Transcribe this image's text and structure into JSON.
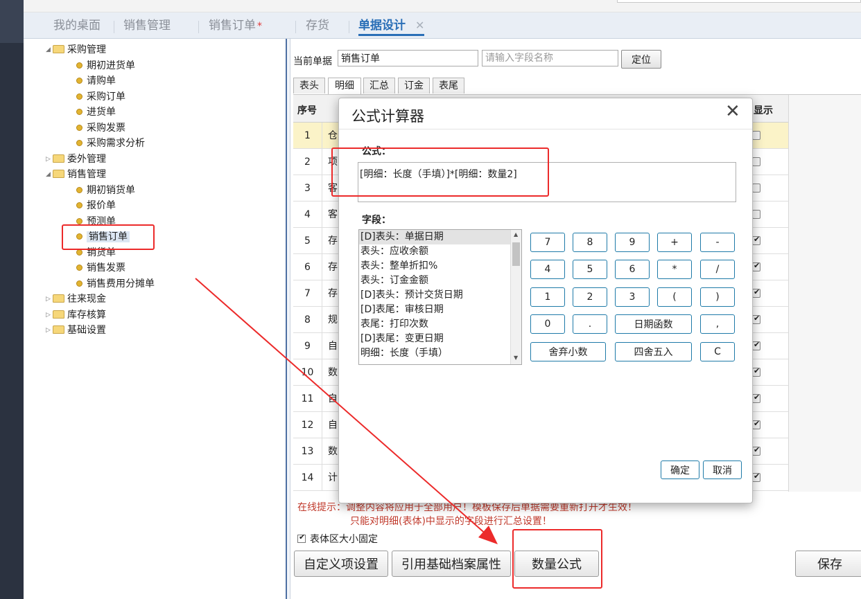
{
  "tabs": [
    {
      "label": "我的桌面"
    },
    {
      "label": "销售管理"
    },
    {
      "label": "销售订单",
      "modified": "*"
    },
    {
      "label": "存货"
    },
    {
      "label": "单据设计",
      "close": "✕"
    }
  ],
  "tree": {
    "groups": [
      {
        "label": "采购管理",
        "toggle": "◢",
        "children": [
          "期初进货单",
          "请购单",
          "采购订单",
          "进货单",
          "采购发票",
          "采购需求分析"
        ]
      },
      {
        "label": "委外管理",
        "toggle": "▷"
      },
      {
        "label": "销售管理",
        "toggle": "◢",
        "children": [
          "期初销货单",
          "报价单",
          "预测单",
          "销售订单",
          "销货单",
          "销售发票",
          "销售费用分摊单"
        ]
      },
      {
        "label": "往来现金",
        "toggle": "▷"
      },
      {
        "label": "库存核算",
        "toggle": "▷"
      },
      {
        "label": "基础设置",
        "toggle": "▷"
      }
    ]
  },
  "main": {
    "current_label": "当前单据",
    "current_value": "销售订单",
    "search_placeholder": "请输入字段名称",
    "locate_button": "定位",
    "subtabs": [
      "表头",
      "明细",
      "汇总",
      "订金",
      "表尾"
    ],
    "grid": {
      "col_index": "序号",
      "col_show": "显示",
      "rows": [
        {
          "no": "1",
          "text": "仓",
          "checked": false,
          "highlight": true
        },
        {
          "no": "2",
          "text": "项",
          "checked": false
        },
        {
          "no": "3",
          "text": "客",
          "checked": false
        },
        {
          "no": "4",
          "text": "客",
          "checked": false
        },
        {
          "no": "5",
          "text": "存",
          "checked": true
        },
        {
          "no": "6",
          "text": "存",
          "checked": true
        },
        {
          "no": "7",
          "text": "存",
          "checked": true
        },
        {
          "no": "8",
          "text": "规",
          "checked": true
        },
        {
          "no": "9",
          "text": "自",
          "checked": true
        },
        {
          "no": "10",
          "text": "数",
          "checked": true
        },
        {
          "no": "11",
          "text": "自",
          "checked": true
        },
        {
          "no": "12",
          "text": "自",
          "checked": true
        },
        {
          "no": "13",
          "text": "数",
          "checked": true
        },
        {
          "no": "14",
          "text": "计",
          "checked": true
        }
      ]
    },
    "hint_line1": "在线提示：调整内容将应用于全部用户！模板保存后单据需要重新打开才生效！",
    "hint_line2": "只能对明细(表体)中显示的字段进行汇总设置！",
    "fixed_size_label": "表体区大小固定",
    "btn_custom": "自定义项设置",
    "btn_ref": "引用基础档案属性",
    "btn_qty": "数量公式",
    "btn_save": "保存"
  },
  "dialog": {
    "title": "公式计算器",
    "close": "✕",
    "formula_label": "公式：",
    "formula_value": "[明细：长度（手填）]*[明细：数量2]",
    "fields_label": "字段：",
    "fields": [
      "[D]表头：单据日期",
      "表头：应收余额",
      "表头：整单折扣%",
      "表头：订金金额",
      "[D]表头：预计交货日期",
      "[D]表尾：审核日期",
      "表尾：打印次数",
      "[D]表尾：变更日期",
      "明细：长度（手填）"
    ],
    "keys": {
      "k7": "7",
      "k8": "8",
      "k9": "9",
      "plus": "+",
      "minus": "-",
      "k4": "4",
      "k5": "5",
      "k6": "6",
      "mul": "*",
      "div": "/",
      "k1": "1",
      "k2": "2",
      "k3": "3",
      "lp": "(",
      "rp": ")",
      "k0": "0",
      "dot": ".",
      "datefn": "日期函数",
      "comma": ",",
      "trunc": "舍弃小数",
      "round": "四舍五入",
      "clear": "C"
    },
    "ok": "确定",
    "cancel": "取消"
  }
}
